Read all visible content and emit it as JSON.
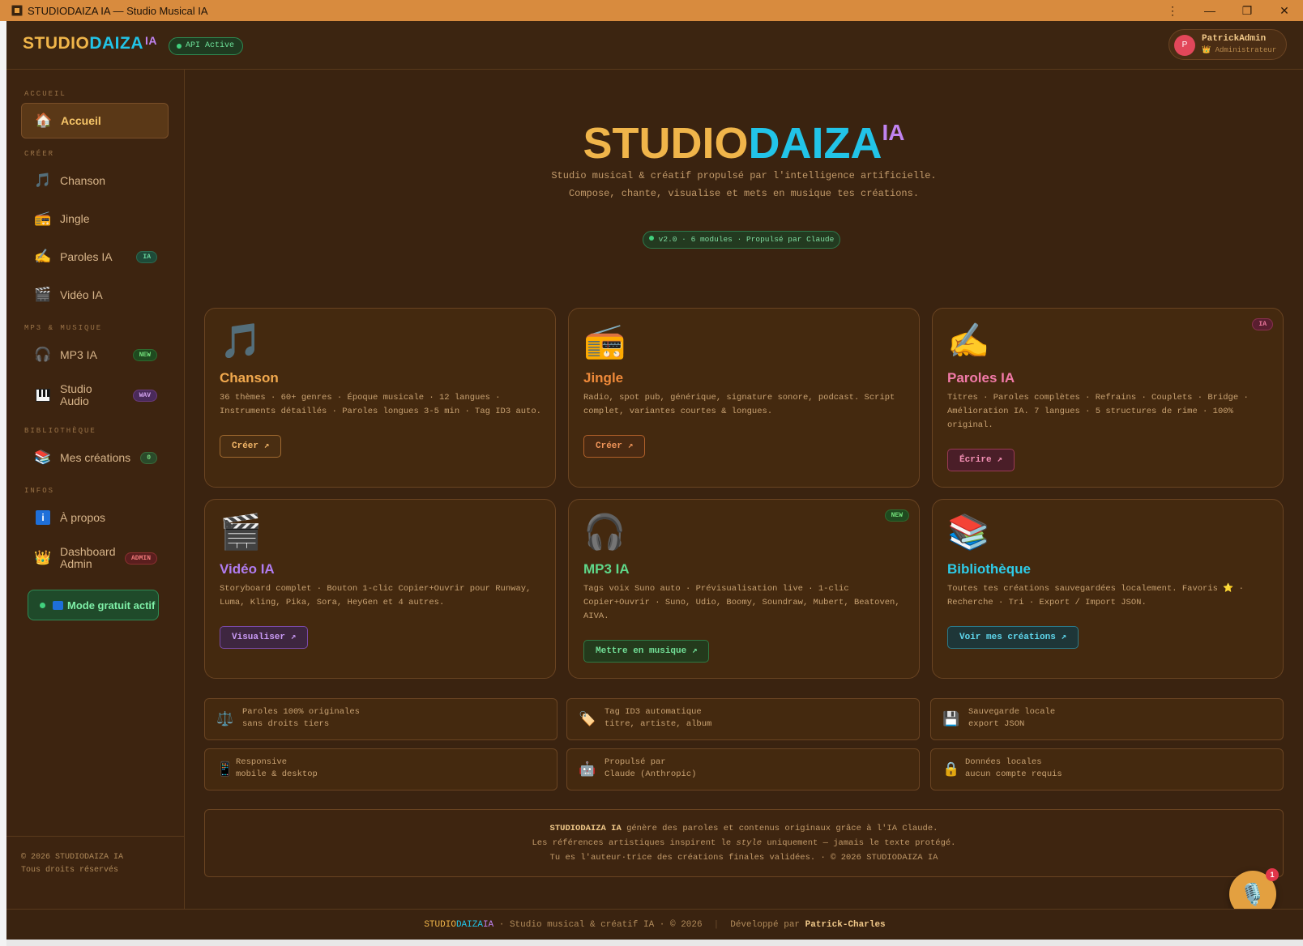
{
  "window": {
    "title": "STUDIODAIZA IA — Studio Musical IA",
    "controls": {
      "menu": "⋮",
      "minimize": "—",
      "restore": "❐",
      "close": "✕"
    }
  },
  "header": {
    "logo": {
      "part1": "STUDIO",
      "part2": "DAIZA",
      "part3": "IA"
    },
    "api_badge": "API Active",
    "user": {
      "avatar_letter": "P",
      "name": "PatrickAdmin",
      "role": "👑 Administrateur"
    }
  },
  "sidebar": {
    "sections": {
      "accueil": "ACCUEIL",
      "creer": "CRÉER",
      "mp3": "MP3 & MUSIQUE",
      "bibliotheque": "BIBLIOTHÈQUE",
      "infos": "INFOS"
    },
    "items": {
      "accueil": {
        "label": "Accueil",
        "icon": "house-icon"
      },
      "chanson": {
        "label": "Chanson",
        "icon": "music-note-icon"
      },
      "jingle": {
        "label": "Jingle",
        "icon": "radio-icon"
      },
      "paroles": {
        "label": "Paroles IA",
        "badge": "IA",
        "icon": "pencil-icon"
      },
      "video": {
        "label": "Vidéo IA",
        "icon": "clapper-icon"
      },
      "mp3": {
        "label": "MP3 IA",
        "badge": "NEW",
        "icon": "headphones-icon"
      },
      "studio_audio": {
        "label_line1": "Studio",
        "label_line2": "Audio",
        "badge": "WAV",
        "icon": "piano-icon"
      },
      "creations": {
        "label": "Mes créations",
        "badge": "0",
        "icon": "books-icon"
      },
      "apropos": {
        "label": "À propos",
        "icon": "info-icon"
      },
      "dashboard": {
        "label_line1": "Dashboard",
        "label_line2": "Admin",
        "badge": "ADMIN",
        "icon": "crown-icon"
      }
    },
    "free_mode": "Mode gratuit actif",
    "footer": {
      "line1": "© 2026 STUDIODAIZA IA",
      "line2": "Tous droits réservés"
    }
  },
  "hero": {
    "title": {
      "part1": "STUDIO",
      "part2": "DAIZA",
      "part3": "IA"
    },
    "subtitle_line1": "Studio musical & créatif propulsé par l'intelligence artificielle.",
    "subtitle_line2": "Compose, chante, visualise et mets en musique tes créations.",
    "version_pill": "v2.0 · 6 modules · Propulsé par Claude"
  },
  "cards": [
    {
      "title": "Chanson",
      "title_color": "#f2a94e",
      "icon": "music-note-icon",
      "glyph": "🎵",
      "desc": "36 thèmes · 60+ genres · Époque musicale · 12 langues · Instruments détaillés · Paroles longues 3-5 min · Tag ID3 auto.",
      "button": "Créer ↗"
    },
    {
      "title": "Jingle",
      "title_color": "#f08a3a",
      "icon": "radio-icon",
      "glyph": "📻",
      "desc": "Radio, spot pub, générique, signature sonore, podcast. Script complet, variantes courtes & longues.",
      "button": "Créer ↗"
    },
    {
      "title": "Paroles IA",
      "title_color": "#f27aa8",
      "icon": "pencil-icon",
      "glyph": "✍️",
      "desc": "Titres · Paroles complètes · Refrains · Couplets · Bridge · Amélioration IA. 7 langues · 5 structures de rime · 100% original.",
      "button": "Écrire ↗",
      "tag": "IA"
    },
    {
      "title": "Vidéo IA",
      "title_color": "#b07cf0",
      "icon": "clapper-icon",
      "glyph": "🎬",
      "desc": "Storyboard complet · Bouton 1-clic Copier+Ouvrir pour Runway, Luma, Kling, Pika, Sora, HeyGen et 4 autres.",
      "button": "Visualiser ↗"
    },
    {
      "title": "MP3 IA",
      "title_color": "#5fd88a",
      "icon": "headphones-icon",
      "glyph": "🎧",
      "desc": "Tags voix Suno auto · Prévisualisation live · 1-clic Copier+Ouvrir · Suno, Udio, Boomy, Soundraw, Mubert, Beatoven, AIVA.",
      "button": "Mettre en musique ↗",
      "tag": "NEW"
    },
    {
      "title": "Bibliothèque",
      "title_color": "#2ecbe8",
      "icon": "books-icon",
      "glyph": "📚",
      "desc": "Toutes tes créations sauvegardées localement. Favoris ⭐ · Recherche · Tri · Export / Import JSON.",
      "button": "Voir mes créations ↗"
    }
  ],
  "features": [
    {
      "icon": "scales-icon",
      "glyph": "⚖️",
      "line1": "Paroles 100% originales",
      "line2": "sans droits tiers"
    },
    {
      "icon": "tag-icon",
      "glyph": "🏷️",
      "line1": "Tag ID3 automatique",
      "line2": "titre, artiste, album"
    },
    {
      "icon": "floppy-icon",
      "glyph": "💾",
      "line1": "Sauvegarde locale",
      "line2": "export JSON"
    },
    {
      "icon": "phone-icon",
      "glyph": "📱",
      "line1": "Responsive",
      "line2": "mobile & desktop"
    },
    {
      "icon": "robot-icon",
      "glyph": "🤖",
      "line1": "Propulsé par",
      "line2": "Claude (Anthropic)"
    },
    {
      "icon": "lock-icon",
      "glyph": "🔒",
      "line1": "Données locales",
      "line2": "aucun compte requis"
    }
  ],
  "disclaimer": {
    "brand": "STUDIODAIZA IA",
    "line1_rest": " génère des paroles et contenus originaux grâce à l'IA Claude.",
    "line2_pre": "Les références artistiques inspirent le ",
    "line2_em": "style",
    "line2_post": " uniquement — jamais le texte protégé.",
    "line3": "Tu es l'auteur·trice des créations finales validées. · © 2026 STUDIODAIZA IA"
  },
  "chat": {
    "icon": "microphone-icon",
    "notifications": "1"
  },
  "footer": {
    "brand1": "STUDIO",
    "brand2": "DAIZA",
    "brand3": "IA",
    "text": " · Studio musical & créatif IA · © 2026",
    "dev_label": "Développé par ",
    "dev_name": "Patrick-Charles"
  }
}
